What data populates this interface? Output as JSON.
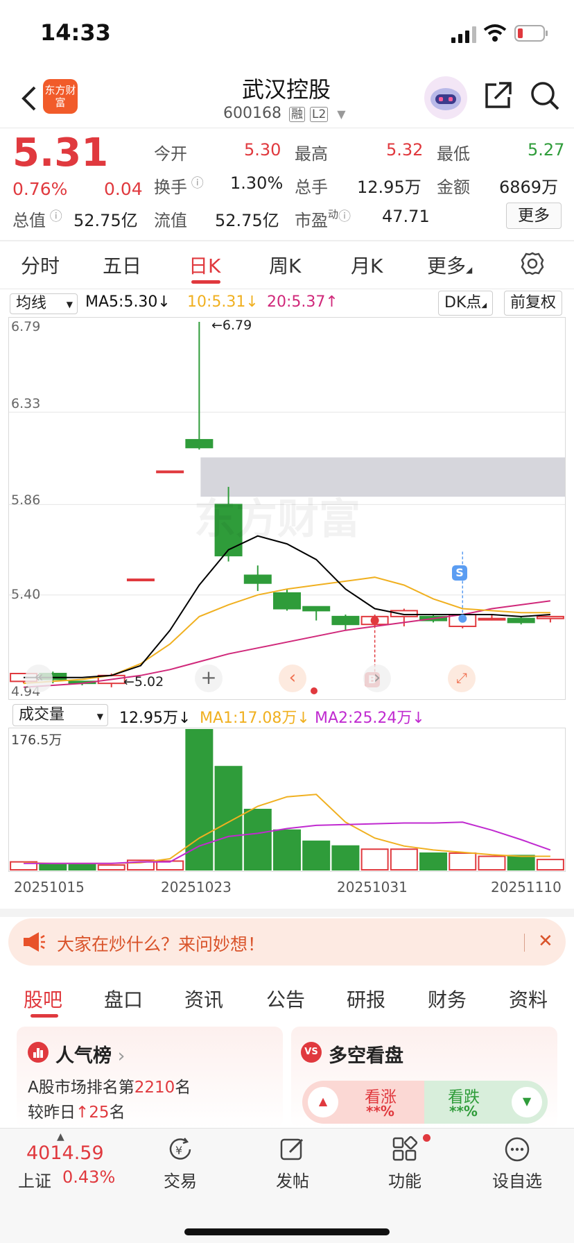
{
  "status_bar": {
    "time": "14:33"
  },
  "header": {
    "title": "武汉控股",
    "code": "600168",
    "badge_rong": "融",
    "badge_l2": "L2",
    "logo_text": "东方财富"
  },
  "quote": {
    "price": "5.31",
    "change_pct": "0.76%",
    "change_abs": "0.04",
    "open_label": "今开",
    "open": "5.30",
    "high_label": "最高",
    "high": "5.32",
    "low_label": "最低",
    "low": "5.27",
    "turnover_label": "换手",
    "turnover": "1.30%",
    "volume_label": "总手",
    "volume": "12.95万",
    "amount_label": "金额",
    "amount": "6869万",
    "mktcap_label": "总值",
    "mktcap": "52.75亿",
    "float_label": "流值",
    "float": "52.75亿",
    "pe_label": "市盈",
    "pe_sup": "动",
    "pe": "47.71",
    "more_label": "更多"
  },
  "period_tabs": [
    "分时",
    "五日",
    "日K",
    "周K",
    "月K",
    "更多"
  ],
  "active_period": "日K",
  "ma_bar": {
    "select": "均线",
    "ma5": "MA5:5.30↓",
    "ma10": "10:5.31↓",
    "ma20": "20:5.37↑",
    "dk": "DK点",
    "fq": "前复权"
  },
  "kline": {
    "y_labels": [
      "6.79",
      "6.33",
      "5.86",
      "5.40",
      "4.94"
    ],
    "max_marker": "←6.79",
    "min_marker": "←5.02",
    "marker_s": "S",
    "marker_b": "B",
    "watermark": "东方财富"
  },
  "vol_bar": {
    "select": "成交量",
    "vol": "12.95万↓",
    "ma1": "MA1:17.08万↓",
    "ma2": "MA2:25.24万↓",
    "y_max": "176.5万"
  },
  "dates": [
    "20251015",
    "20251023",
    "20251031",
    "20251110"
  ],
  "banner": {
    "text": "大家在炒什么？来问妙想！"
  },
  "info_tabs": [
    "股吧",
    "盘口",
    "资讯",
    "公告",
    "研报",
    "财务",
    "资料"
  ],
  "active_info_tab": "股吧",
  "popularity": {
    "title": "人气榜",
    "rank_prefix": "A股市场排名第",
    "rank": "2210",
    "rank_suffix": "名",
    "change_prefix": "较昨日",
    "change_arrow": "↑",
    "change": "25",
    "change_suffix": "名"
  },
  "bullbear": {
    "title": "多空看盘",
    "up_label": "看涨",
    "up_value": "**%",
    "down_label": "看跌",
    "down_value": "**%"
  },
  "index": {
    "value": "4014.59",
    "name": "上证",
    "pct": "0.43%"
  },
  "bottom_nav": [
    "交易",
    "发帖",
    "功能",
    "设自选"
  ],
  "colors": {
    "up": "#e0393e",
    "down": "#2f9c3a",
    "ma5": "#000000",
    "ma10": "#f0b020",
    "ma20": "#d0287a"
  },
  "chart_data": {
    "type": "candlestick",
    "candles": [
      {
        "o": 4.96,
        "c": 5.0,
        "h": 5.0,
        "l": 4.95
      },
      {
        "o": 5.0,
        "c": 4.97,
        "h": 5.01,
        "l": 4.95
      },
      {
        "o": 4.96,
        "c": 4.95,
        "h": 4.96,
        "l": 4.94
      },
      {
        "o": 4.95,
        "c": 4.99,
        "h": 5.0,
        "l": 4.93
      },
      {
        "o": 5.48,
        "c": 5.48,
        "h": 5.48,
        "l": 5.48
      },
      {
        "o": 6.03,
        "c": 6.03,
        "h": 6.03,
        "l": 6.03
      },
      {
        "o": 6.19,
        "c": 6.15,
        "h": 6.79,
        "l": 6.14
      },
      {
        "o": 5.86,
        "c": 5.6,
        "h": 5.95,
        "l": 5.57
      },
      {
        "o": 5.5,
        "c": 5.46,
        "h": 5.55,
        "l": 5.42
      },
      {
        "o": 5.41,
        "c": 5.33,
        "h": 5.43,
        "l": 5.32
      },
      {
        "o": 5.34,
        "c": 5.32,
        "h": 5.34,
        "l": 5.27
      },
      {
        "o": 5.29,
        "c": 5.25,
        "h": 5.3,
        "l": 5.22
      },
      {
        "o": 5.25,
        "c": 5.29,
        "h": 5.3,
        "l": 5.24
      },
      {
        "o": 5.29,
        "c": 5.32,
        "h": 5.33,
        "l": 5.24
      },
      {
        "o": 5.29,
        "c": 5.27,
        "h": 5.3,
        "l": 5.26
      },
      {
        "o": 5.24,
        "c": 5.3,
        "h": 5.3,
        "l": 5.23
      },
      {
        "o": 5.28,
        "c": 5.28,
        "h": 5.3,
        "l": 5.27
      },
      {
        "o": 5.28,
        "c": 5.26,
        "h": 5.29,
        "l": 5.25
      },
      {
        "o": 5.28,
        "c": 5.29,
        "h": 5.29,
        "l": 5.26
      }
    ],
    "ma5": [
      4.98,
      4.98,
      4.98,
      4.99,
      5.04,
      5.22,
      5.45,
      5.63,
      5.7,
      5.66,
      5.58,
      5.43,
      5.33,
      5.3,
      5.3,
      5.3,
      5.3,
      5.29,
      5.3
    ],
    "ma10": [
      4.95,
      4.96,
      4.97,
      4.99,
      5.05,
      5.15,
      5.29,
      5.35,
      5.4,
      5.43,
      5.45,
      5.47,
      5.49,
      5.45,
      5.38,
      5.33,
      5.32,
      5.31,
      5.31
    ],
    "ma20": [
      4.93,
      4.94,
      4.95,
      4.97,
      4.99,
      5.02,
      5.06,
      5.1,
      5.13,
      5.16,
      5.19,
      5.22,
      5.24,
      5.26,
      5.28,
      5.3,
      5.33,
      5.35,
      5.37
    ],
    "ylim": [
      4.94,
      6.79
    ],
    "gap_zone": [
      5.9,
      6.1
    ],
    "volume": [
      10,
      7,
      7,
      6,
      12,
      11,
      176.5,
      130,
      76,
      50,
      36,
      30,
      26,
      26,
      21,
      21,
      17,
      18,
      13
    ],
    "volume_ma1": [
      9,
      8,
      8,
      8,
      9,
      14,
      40,
      60,
      80,
      92,
      95,
      60,
      40,
      30,
      25,
      22,
      19,
      17,
      17
    ],
    "volume_ma2": [
      8,
      8,
      8,
      8,
      10,
      10,
      30,
      42,
      46,
      52,
      56,
      57,
      58,
      59,
      59,
      60,
      50,
      38,
      25
    ],
    "volume_ylim": [
      0,
      176.5
    ]
  }
}
